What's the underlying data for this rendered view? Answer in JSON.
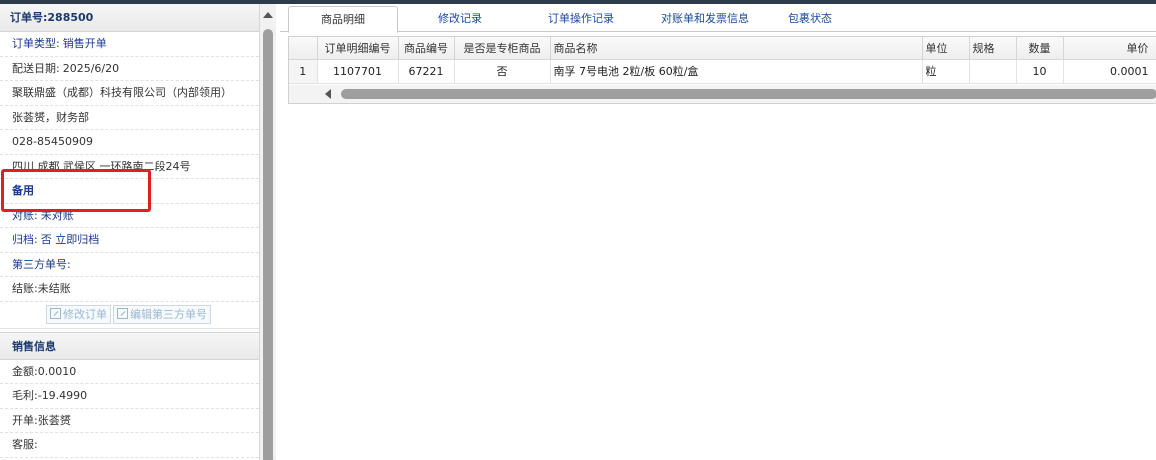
{
  "order": {
    "header_label": "订单号:",
    "number": "288500",
    "rows": [
      {
        "label": "订单类型:",
        "value": "销售开单"
      },
      {
        "label": "配送日期:",
        "value": "2025/6/20"
      },
      {
        "label": "",
        "value": "聚联鼎盛（成都）科技有限公司（内部领用）"
      },
      {
        "label": "",
        "value": "张荟赟，财务部"
      },
      {
        "label": "",
        "value": "028-85450909"
      },
      {
        "label": "",
        "value": "四川 成都 武侯区 一环路南二段24号"
      },
      {
        "label": "",
        "value": "备用"
      },
      {
        "label": "对账:",
        "value": "未对账"
      },
      {
        "label": "归档:",
        "value": "否 立即归档"
      },
      {
        "label": "第三方单号:",
        "value": ""
      },
      {
        "label": "结账:",
        "value": "未结账"
      }
    ],
    "buttons": {
      "edit_order": "修改订单",
      "edit_third_party": "编辑第三方单号"
    }
  },
  "sales": {
    "header": "销售信息",
    "rows": [
      {
        "label": "金额:",
        "value": "0.0010"
      },
      {
        "label": "毛利:",
        "value": "-19.4990"
      },
      {
        "label": "开单:",
        "value": "张荟赟"
      },
      {
        "label": "客服:",
        "value": ""
      }
    ]
  },
  "tabs": [
    {
      "label": "商品明细",
      "active": true
    },
    {
      "label": "修改记录",
      "active": false
    },
    {
      "label": "订单操作记录",
      "active": false
    },
    {
      "label": "对账单和发票信息",
      "active": false
    },
    {
      "label": "包裹状态",
      "active": false
    }
  ],
  "grid": {
    "columns": [
      "",
      "订单明细编号",
      "商品编号",
      "是否是专柜商品",
      "商品名称",
      "单位",
      "规格",
      "数量",
      "单价"
    ],
    "rows": [
      [
        "1",
        "1107701",
        "67221",
        "否",
        "南孚 7号电池 2粒/板 60粒/盒",
        "粒",
        "",
        "10",
        "0.0001"
      ]
    ]
  },
  "colors": {
    "link": "#1a3a9b",
    "header_text": "#1a3a6b",
    "highlight": "#e02020"
  },
  "icons": [
    "edit-icon",
    "scroll-up-arrow-icon",
    "scroll-left-arrow-icon"
  ]
}
